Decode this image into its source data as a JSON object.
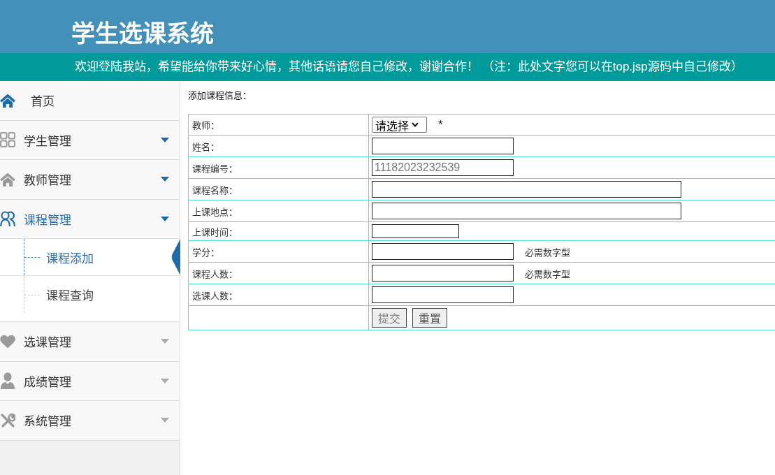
{
  "header": {
    "title": "学生选课系统",
    "notice": "欢迎登陆我站，希望能给你带来好心情，其他话语请您自己修改，谢谢合作！ （注：此处文字您可以在top.jsp源码中自己修改）"
  },
  "sidebar": {
    "items": [
      {
        "label": "首页",
        "kind": "link",
        "active": false
      },
      {
        "label": "学生管理",
        "kind": "menu",
        "active": false,
        "color": "#1b6ca8"
      },
      {
        "label": "教师管理",
        "kind": "menu",
        "active": false,
        "color": "#1b6ca8"
      },
      {
        "label": "课程管理",
        "kind": "menu",
        "active": true,
        "color": "#1b6ca8",
        "children": [
          {
            "label": "课程添加",
            "selected": true
          },
          {
            "label": "课程查询",
            "selected": false
          }
        ]
      },
      {
        "label": "选课管理",
        "kind": "menu",
        "active": false,
        "color": "#aaaaaa"
      },
      {
        "label": "成绩管理",
        "kind": "menu",
        "active": false,
        "color": "#aaaaaa"
      },
      {
        "label": "系统管理",
        "kind": "menu",
        "active": false,
        "color": "#aaaaaa"
      }
    ]
  },
  "form": {
    "title": "添加课程信息：",
    "rows": [
      {
        "label": "教师：",
        "kind": "select",
        "value": "请选择",
        "note": "*"
      },
      {
        "label": "姓名：",
        "kind": "input"
      },
      {
        "label": "课程编号：",
        "kind": "input",
        "readonly": true,
        "value": "11182023232539"
      },
      {
        "label": "课程名称：",
        "kind": "input"
      },
      {
        "label": "上课地点：",
        "kind": "input"
      },
      {
        "label": "上课时间：",
        "kind": "input"
      },
      {
        "label": "学分：",
        "kind": "input",
        "note": "必需数字型"
      },
      {
        "label": "课程人数：",
        "kind": "input",
        "note": "必需数字型"
      },
      {
        "label": "选课人数：",
        "kind": "input"
      },
      {
        "kind": "buttons",
        "buttons": [
          {
            "label": "提交",
            "kind": "submit"
          },
          {
            "label": "重置",
            "kind": "reset"
          }
        ]
      }
    ]
  }
}
